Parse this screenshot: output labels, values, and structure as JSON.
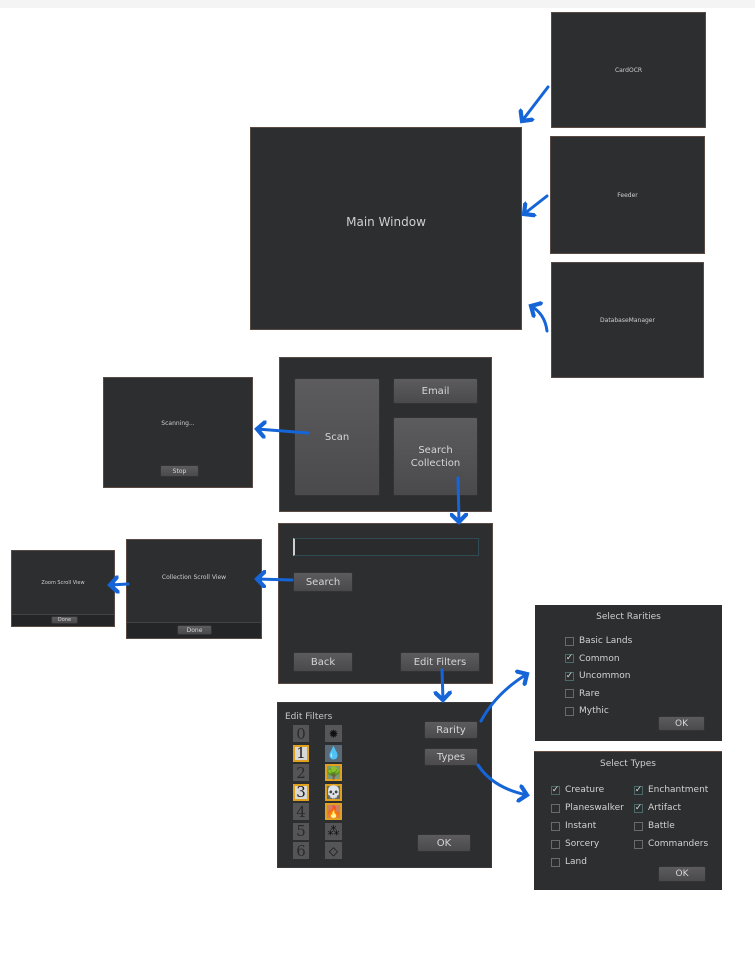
{
  "windows": {
    "card_ocr": {
      "title": "CardOCR"
    },
    "feeder": {
      "title": "Feeder"
    },
    "database_manager": {
      "title": "DatabaseManager"
    },
    "main_window": {
      "title": "Main Window"
    }
  },
  "home_screen": {
    "scan_label": "Scan",
    "email_label": "Email",
    "search_collection_label": "Search\nCollection"
  },
  "scanning_screen": {
    "status_text": "Scanning...",
    "stop_label": "Stop"
  },
  "search_screen": {
    "search_input_value": "",
    "search_label": "Search",
    "back_label": "Back",
    "edit_filters_label": "Edit Filters"
  },
  "collection_scroll_view": {
    "title": "Collection Scroll View",
    "done_label": "Done"
  },
  "zoom_scroll_view": {
    "title": "Zoom Scroll View",
    "done_label": "Done"
  },
  "edit_filters": {
    "title": "Edit Filters",
    "mana_costs": [
      {
        "label": "0",
        "selected": false
      },
      {
        "label": "1",
        "selected": true
      },
      {
        "label": "2",
        "selected": false
      },
      {
        "label": "3",
        "selected": true
      },
      {
        "label": "4",
        "selected": false
      },
      {
        "label": "5",
        "selected": false
      },
      {
        "label": "6",
        "selected": false
      }
    ],
    "colors": [
      {
        "name": "white",
        "glyph": "✹",
        "selected": false
      },
      {
        "name": "blue",
        "glyph": "💧",
        "selected": false
      },
      {
        "name": "green",
        "glyph": "🌳",
        "selected": true
      },
      {
        "name": "black",
        "glyph": "💀",
        "selected": true
      },
      {
        "name": "red",
        "glyph": "🔥",
        "selected": true
      },
      {
        "name": "multicolor",
        "glyph": "⁂",
        "selected": false
      },
      {
        "name": "colorless",
        "glyph": "◇",
        "selected": false
      }
    ],
    "rarity_label": "Rarity",
    "types_label": "Types",
    "ok_label": "OK"
  },
  "select_rarities": {
    "title": "Select Rarities",
    "options": [
      {
        "label": "Basic Lands",
        "checked": false
      },
      {
        "label": "Common",
        "checked": true
      },
      {
        "label": "Uncommon",
        "checked": true
      },
      {
        "label": "Rare",
        "checked": false
      },
      {
        "label": "Mythic",
        "checked": false
      }
    ],
    "ok_label": "OK"
  },
  "select_types": {
    "title": "Select Types",
    "options_left": [
      {
        "label": "Creature",
        "checked": true
      },
      {
        "label": "Planeswalker",
        "checked": false
      },
      {
        "label": "Instant",
        "checked": false
      },
      {
        "label": "Sorcery",
        "checked": false
      },
      {
        "label": "Land",
        "checked": false
      }
    ],
    "options_right": [
      {
        "label": "Enchantment",
        "checked": true
      },
      {
        "label": "Artifact",
        "checked": true
      },
      {
        "label": "Battle",
        "checked": false
      },
      {
        "label": "Commanders",
        "checked": false
      }
    ],
    "ok_label": "OK"
  },
  "colors": {
    "window_bg": "#2d2e30",
    "arrow": "#1565d8",
    "selected_outline": "#e0a020"
  }
}
